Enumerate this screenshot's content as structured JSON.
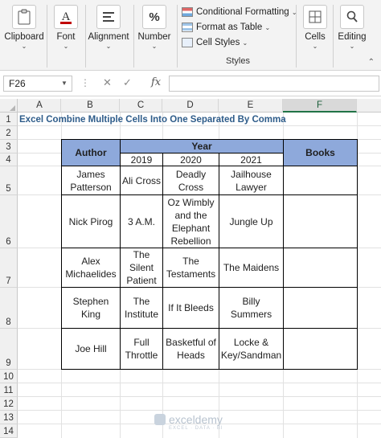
{
  "ribbon": {
    "clipboard": {
      "label": "Clipboard",
      "icon": "clipboard-icon"
    },
    "font": {
      "label": "Font",
      "icon": "font-icon"
    },
    "alignment": {
      "label": "Alignment",
      "icon": "alignment-icon"
    },
    "number": {
      "label": "Number",
      "icon": "percent-icon",
      "glyph": "%"
    },
    "styles": {
      "conditional_formatting": "Conditional Formatting",
      "format_as_table": "Format as Table",
      "cell_styles": "Cell Styles",
      "caption": "Styles"
    },
    "cells": {
      "label": "Cells",
      "icon": "cells-icon"
    },
    "editing": {
      "label": "Editing",
      "icon": "search-icon"
    }
  },
  "formula_bar": {
    "name_box": "F26",
    "fx": "fx",
    "content": ""
  },
  "columns": [
    "A",
    "B",
    "C",
    "D",
    "E",
    "F"
  ],
  "selected_column": "F",
  "rows": [
    "1",
    "2",
    "3",
    "4",
    "5",
    "6",
    "7",
    "8",
    "9",
    "10",
    "11",
    "12",
    "13",
    "14"
  ],
  "sheet": {
    "title": "Excel Combine Multiple Cells Into One Separated By Comma",
    "headers": {
      "author": "Author",
      "year": "Year",
      "books": "Books",
      "years": [
        "2019",
        "2020",
        "2021"
      ]
    },
    "data": [
      {
        "author": "James Patterson",
        "y2019": "Ali Cross",
        "y2020": "Deadly Cross",
        "y2021": "Jailhouse Lawyer",
        "books": ""
      },
      {
        "author": "Nick Pirog",
        "y2019": "3 A.M.",
        "y2020": "Oz Wimbly and the Elephant Rebellion",
        "y2021": "Jungle Up",
        "books": ""
      },
      {
        "author": "Alex Michaelides",
        "y2019": "The Silent Patient",
        "y2020": "The Testaments",
        "y2021": "The Maidens",
        "books": ""
      },
      {
        "author": "Stephen King",
        "y2019": "The Institute",
        "y2020": "If It Bleeds",
        "y2021": "Billy Summers",
        "books": ""
      },
      {
        "author": "Joe Hill",
        "y2019": "Full Throttle",
        "y2020": "Basketful of Heads",
        "y2021": "Locke & Key/Sandman",
        "books": ""
      }
    ]
  },
  "watermark": {
    "name": "exceldemy",
    "tagline": "EXCEL · DATA · BI"
  },
  "colors": {
    "header_fill": "#8ea9db",
    "title_text": "#2e5c8a",
    "excel_green": "#217346"
  }
}
